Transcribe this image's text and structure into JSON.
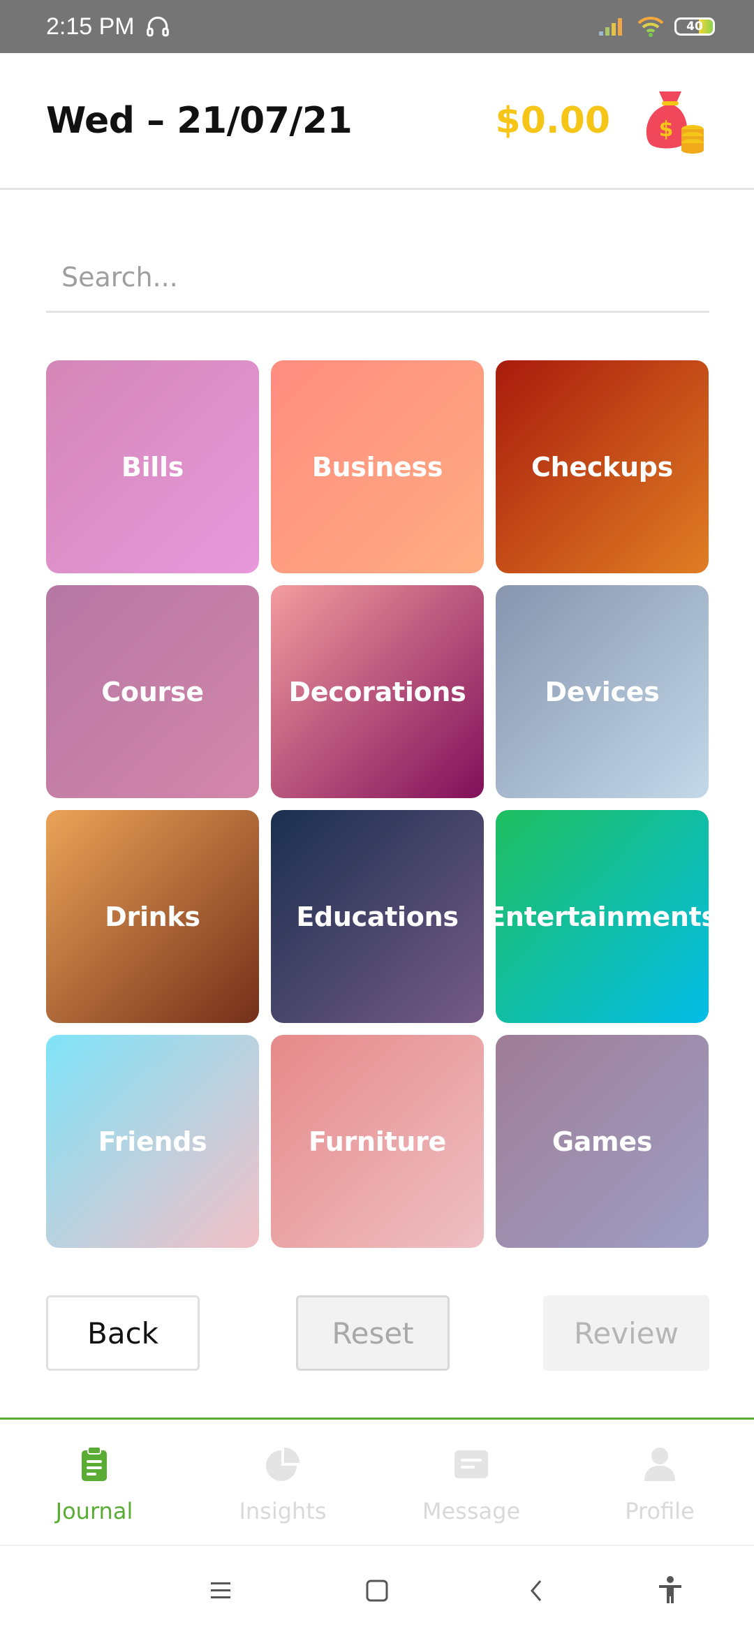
{
  "status_bar": {
    "time": "2:15 PM",
    "battery": "40",
    "icons": [
      "headset-icon",
      "signal-icon",
      "wifi-icon",
      "battery-icon"
    ]
  },
  "header": {
    "date": "Wed – 21/07/21",
    "balance": "$0.00",
    "balance_color": "#f5c518",
    "icon": "money-bag-icon"
  },
  "search": {
    "placeholder": "Search...",
    "value": ""
  },
  "categories": [
    {
      "label": "Bills",
      "colors": [
        "#d487b6",
        "#e798dc"
      ]
    },
    {
      "label": "Business",
      "colors": [
        "#ff8c80",
        "#ffad82"
      ]
    },
    {
      "label": "Checkups",
      "colors": [
        "#a91b0d",
        "#e07e24"
      ]
    },
    {
      "label": "Course",
      "colors": [
        "#b577a3",
        "#d487aa"
      ]
    },
    {
      "label": "Decorations",
      "colors": [
        "#f29c9f",
        "#80105a"
      ]
    },
    {
      "label": "Devices",
      "colors": [
        "#8795ae",
        "#c3d8e9"
      ]
    },
    {
      "label": "Drinks",
      "colors": [
        "#eba458",
        "#742f1a"
      ]
    },
    {
      "label": "Educations",
      "colors": [
        "#1b2f4e",
        "#755b87"
      ]
    },
    {
      "label": "Entertainments",
      "colors": [
        "#1fbe5f",
        "#04bde8"
      ]
    },
    {
      "label": "Friends",
      "colors": [
        "#7fe4f8",
        "#f2bfc6"
      ]
    },
    {
      "label": "Furniture",
      "colors": [
        "#e68989",
        "#eec0c4"
      ]
    },
    {
      "label": "Games",
      "colors": [
        "#9f7d96",
        "#9e9fc4"
      ]
    }
  ],
  "actions": {
    "back": "Back",
    "reset": "Reset",
    "review": "Review"
  },
  "tabs": [
    {
      "label": "Journal",
      "icon": "clipboard-icon",
      "active": true
    },
    {
      "label": "Insights",
      "icon": "pie-chart-icon",
      "active": false
    },
    {
      "label": "Message",
      "icon": "message-icon",
      "active": false
    },
    {
      "label": "Profile",
      "icon": "person-icon",
      "active": false
    }
  ],
  "accent_color": "#5aac35",
  "system_nav": [
    "menu-icon",
    "home-icon",
    "back-arrow-icon",
    "accessibility-icon"
  ]
}
